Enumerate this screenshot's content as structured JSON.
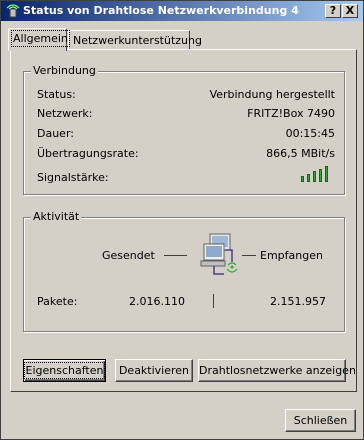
{
  "window": {
    "title": "Status von Drahtlose Netzwerkverbindung 4",
    "help_label": "?",
    "close_label": "X"
  },
  "tabs": [
    {
      "label": "Allgemein",
      "active": true
    },
    {
      "label": "Netzwerkunterstützung",
      "active": false
    }
  ],
  "connection": {
    "title": "Verbindung",
    "rows": [
      {
        "label": "Status:",
        "value": "Verbindung hergestellt"
      },
      {
        "label": "Netzwerk:",
        "value": "FRITZ!Box 7490"
      },
      {
        "label": "Dauer:",
        "value": "00:15:45"
      },
      {
        "label": "Übertragungsrate:",
        "value": "866,5 MBit/s"
      },
      {
        "label": "Signalstärke:",
        "value": ""
      }
    ],
    "signal_bars_filled": 5,
    "signal_bars_total": 5,
    "signal_color": "#3ca03c"
  },
  "activity": {
    "title": "Aktivität",
    "sent_label": "Gesendet",
    "received_label": "Empfangen",
    "packets_label": "Pakete:",
    "packets_sent": "2.016.110",
    "packets_received": "2.151.957"
  },
  "buttons": {
    "properties": "Eigenschaften",
    "deactivate": "Deaktivieren",
    "show_wireless": "Drahtlosnetzwerke anzeigen",
    "close": "Schließen"
  }
}
